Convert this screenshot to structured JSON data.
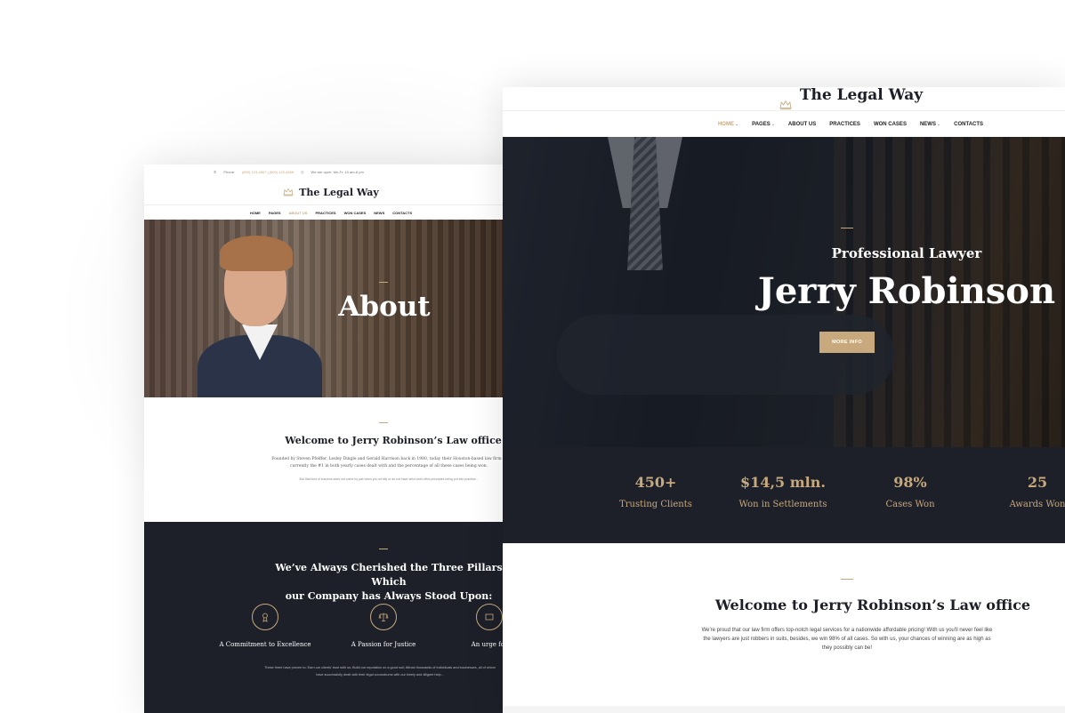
{
  "left_page": {
    "topbar": {
      "phone_label": "Phone:",
      "phone_value": "(800) 123-4567 | (800) 123-4566",
      "hours": "We are open: Mn-Fr: 10 am-8 pm"
    },
    "logo": "The Legal Way",
    "nav": [
      "HOME",
      "PAGES",
      "ABOUT US",
      "PRACTICES",
      "WON CASES",
      "NEWS",
      "CONTACTS"
    ],
    "hero_title": "About",
    "welcome": {
      "title": "Welcome to Jerry Robinson’s Law office",
      "text": "Founded by Steven Pfeiffer, Lesley Dingle and Gerald Harrison back in 1980, today their Houston-based law firm is currently the #1 in both yearly cases dealt with and the percentage of all these cases being won.",
      "small": "But that kind of success does not come by just when you sit idly or do not have strict work ethic principles being put into practice..."
    },
    "pillars": {
      "title_line1": "We’ve Always Cherished the Three Pillars Which",
      "title_line2": "our Company has Always Stood Upon:",
      "items": [
        {
          "label": "A Commitment to Excellence",
          "icon": "award-icon"
        },
        {
          "label": "A Passion for Justice",
          "icon": "scales-icon"
        },
        {
          "label": "An urge for",
          "icon": "pillar-icon"
        }
      ],
      "text_line1": "These three have proven to: Earn our clients' trust with us; Build our reputation on a good soil; Attract thousands of individuals and businesses, all of whom",
      "text_line2": "have successfully dealt with their legal conundrums with our timely and diligent help..."
    }
  },
  "right_page": {
    "logo": "The Legal Way",
    "nav": [
      "HOME",
      "PAGES",
      "ABOUT US",
      "PRACTICES",
      "WON CASES",
      "NEWS",
      "CONTACTS"
    ],
    "hero": {
      "subtitle": "Professional Lawyer",
      "title": "Jerry Robinson",
      "button": "MORE INFO"
    },
    "stats": [
      {
        "value": "450+",
        "label": "Trusting Clients"
      },
      {
        "value": "$14,5 mln.",
        "label": "Won in Settlements"
      },
      {
        "value": "98%",
        "label": "Cases Won"
      },
      {
        "value": "25",
        "label": "Awards Won"
      }
    ],
    "welcome": {
      "title": "Welcome to Jerry Robinson’s Law office",
      "text": "We're proud that our law firm offers top-notch legal services for a nationwide affordable pricing! With us you'll never feel like the lawyers are just robbers in suits, besides, we win 98% of all cases. So with us, your chances of winning are as high as they possibly can be!"
    }
  },
  "colors": {
    "accent": "#c8a97e",
    "dark": "#1d2029"
  }
}
